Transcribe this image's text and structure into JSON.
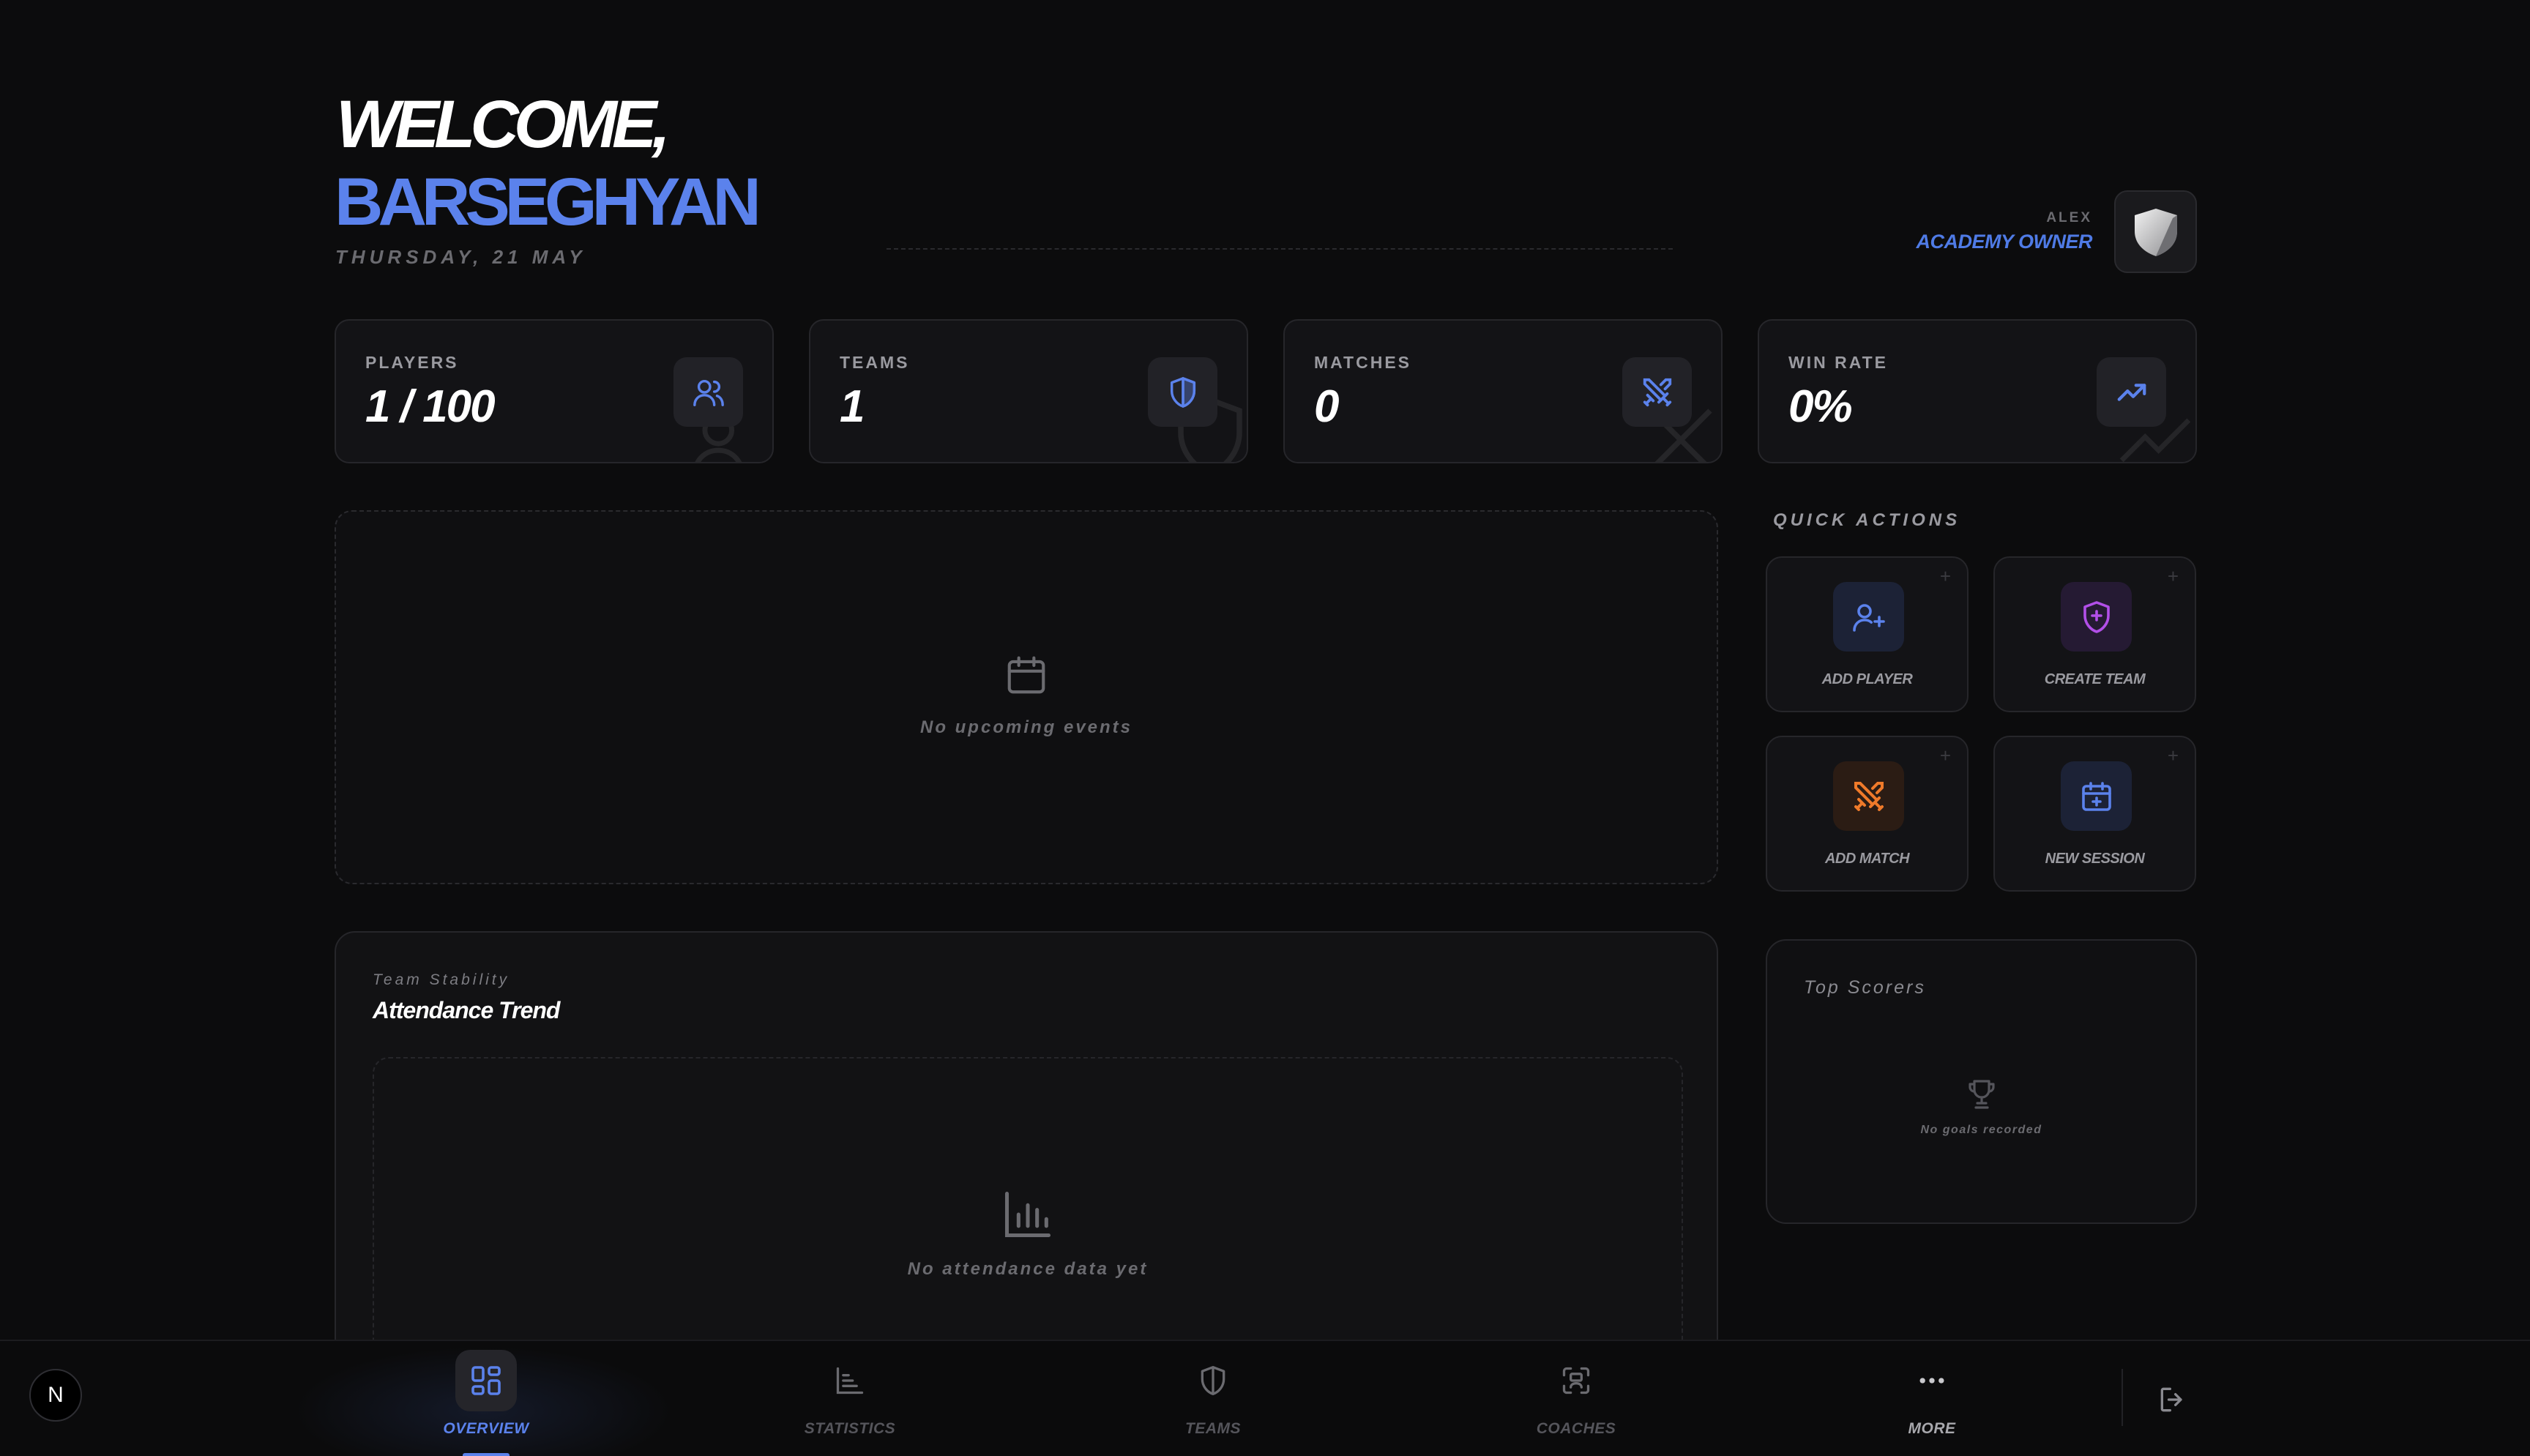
{
  "header": {
    "welcome": "WELCOME,",
    "name": "BARSEGHYAN",
    "date": "THURSDAY, 21 MAY"
  },
  "user": {
    "first_name": "ALEX",
    "role": "ACADEMY OWNER",
    "avatar_icon": "shield-crest-icon"
  },
  "stats": [
    {
      "label": "PLAYERS",
      "value": "1 / 100",
      "icon": "users-icon"
    },
    {
      "label": "TEAMS",
      "value": "1",
      "icon": "shield-icon"
    },
    {
      "label": "MATCHES",
      "value": "0",
      "icon": "swords-icon"
    },
    {
      "label": "WIN RATE",
      "value": "0%",
      "icon": "trending-up-icon"
    }
  ],
  "events": {
    "empty_text": "No upcoming events",
    "icon": "calendar-icon"
  },
  "attendance": {
    "subtitle": "Team Stability",
    "title": "Attendance Trend",
    "empty_text": "No attendance data yet",
    "icon": "bar-chart-icon"
  },
  "quick_actions": {
    "title": "QUICK ACTIONS",
    "items": [
      {
        "label": "ADD PLAYER",
        "icon": "user-plus-icon",
        "color": "#5b82ec"
      },
      {
        "label": "CREATE TEAM",
        "icon": "shield-plus-icon",
        "color": "#b24fe8"
      },
      {
        "label": "ADD MATCH",
        "icon": "swords-icon",
        "color": "#ef7a2a"
      },
      {
        "label": "NEW SESSION",
        "icon": "calendar-plus-icon",
        "color": "#5b82ec"
      }
    ]
  },
  "top_scorers": {
    "title": "Top Scorers",
    "empty_text": "No goals recorded",
    "icon": "trophy-icon"
  },
  "nav": {
    "logo": "N",
    "items": [
      {
        "label": "OVERVIEW",
        "icon": "grid-icon",
        "active": true
      },
      {
        "label": "STATISTICS",
        "icon": "chart-icon",
        "active": false
      },
      {
        "label": "TEAMS",
        "icon": "shield-icon",
        "active": false
      },
      {
        "label": "COACHES",
        "icon": "scan-user-icon",
        "active": false
      },
      {
        "label": "MORE",
        "icon": "more-icon",
        "active": false
      }
    ],
    "logout_icon": "logout-icon"
  },
  "colors": {
    "accent": "#5b82ec",
    "background": "#0c0c0d",
    "card": "#131316"
  }
}
